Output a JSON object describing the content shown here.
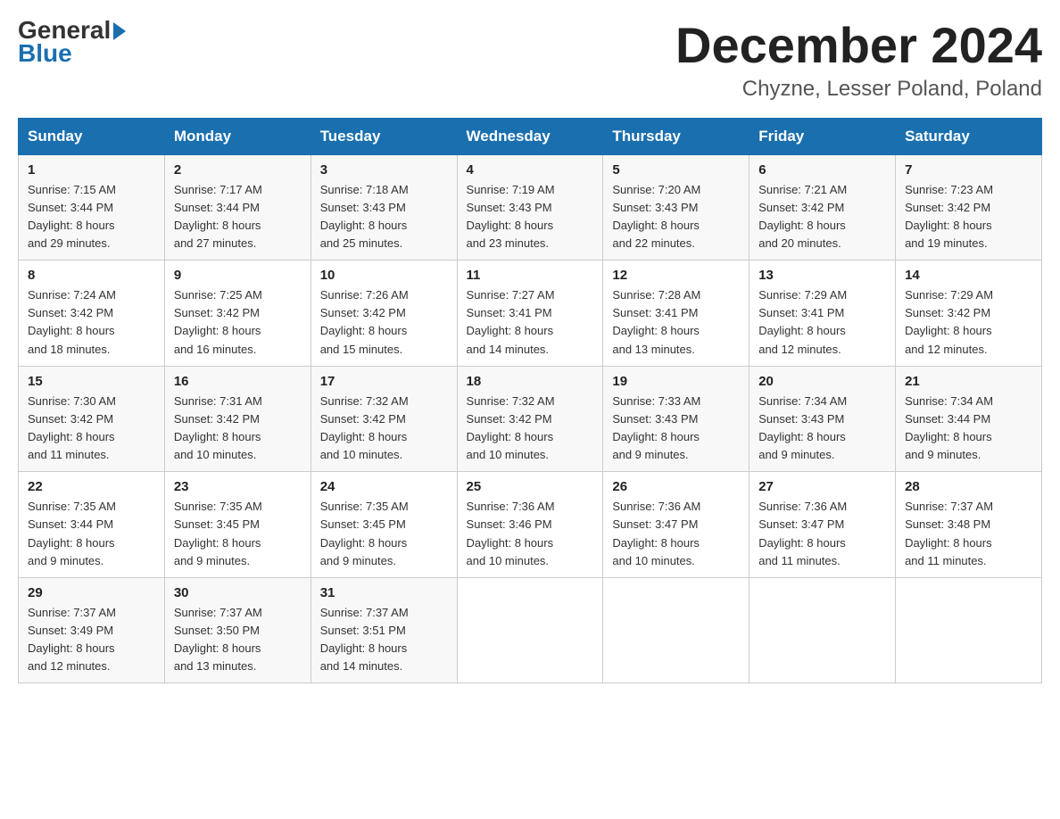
{
  "logo": {
    "general": "General",
    "blue": "Blue"
  },
  "title": "December 2024",
  "location": "Chyzne, Lesser Poland, Poland",
  "days_of_week": [
    "Sunday",
    "Monday",
    "Tuesday",
    "Wednesday",
    "Thursday",
    "Friday",
    "Saturday"
  ],
  "weeks": [
    [
      {
        "day": "1",
        "sunrise": "7:15 AM",
        "sunset": "3:44 PM",
        "daylight": "8 hours and 29 minutes."
      },
      {
        "day": "2",
        "sunrise": "7:17 AM",
        "sunset": "3:44 PM",
        "daylight": "8 hours and 27 minutes."
      },
      {
        "day": "3",
        "sunrise": "7:18 AM",
        "sunset": "3:43 PM",
        "daylight": "8 hours and 25 minutes."
      },
      {
        "day": "4",
        "sunrise": "7:19 AM",
        "sunset": "3:43 PM",
        "daylight": "8 hours and 23 minutes."
      },
      {
        "day": "5",
        "sunrise": "7:20 AM",
        "sunset": "3:43 PM",
        "daylight": "8 hours and 22 minutes."
      },
      {
        "day": "6",
        "sunrise": "7:21 AM",
        "sunset": "3:42 PM",
        "daylight": "8 hours and 20 minutes."
      },
      {
        "day": "7",
        "sunrise": "7:23 AM",
        "sunset": "3:42 PM",
        "daylight": "8 hours and 19 minutes."
      }
    ],
    [
      {
        "day": "8",
        "sunrise": "7:24 AM",
        "sunset": "3:42 PM",
        "daylight": "8 hours and 18 minutes."
      },
      {
        "day": "9",
        "sunrise": "7:25 AM",
        "sunset": "3:42 PM",
        "daylight": "8 hours and 16 minutes."
      },
      {
        "day": "10",
        "sunrise": "7:26 AM",
        "sunset": "3:42 PM",
        "daylight": "8 hours and 15 minutes."
      },
      {
        "day": "11",
        "sunrise": "7:27 AM",
        "sunset": "3:41 PM",
        "daylight": "8 hours and 14 minutes."
      },
      {
        "day": "12",
        "sunrise": "7:28 AM",
        "sunset": "3:41 PM",
        "daylight": "8 hours and 13 minutes."
      },
      {
        "day": "13",
        "sunrise": "7:29 AM",
        "sunset": "3:41 PM",
        "daylight": "8 hours and 12 minutes."
      },
      {
        "day": "14",
        "sunrise": "7:29 AM",
        "sunset": "3:42 PM",
        "daylight": "8 hours and 12 minutes."
      }
    ],
    [
      {
        "day": "15",
        "sunrise": "7:30 AM",
        "sunset": "3:42 PM",
        "daylight": "8 hours and 11 minutes."
      },
      {
        "day": "16",
        "sunrise": "7:31 AM",
        "sunset": "3:42 PM",
        "daylight": "8 hours and 10 minutes."
      },
      {
        "day": "17",
        "sunrise": "7:32 AM",
        "sunset": "3:42 PM",
        "daylight": "8 hours and 10 minutes."
      },
      {
        "day": "18",
        "sunrise": "7:32 AM",
        "sunset": "3:42 PM",
        "daylight": "8 hours and 10 minutes."
      },
      {
        "day": "19",
        "sunrise": "7:33 AM",
        "sunset": "3:43 PM",
        "daylight": "8 hours and 9 minutes."
      },
      {
        "day": "20",
        "sunrise": "7:34 AM",
        "sunset": "3:43 PM",
        "daylight": "8 hours and 9 minutes."
      },
      {
        "day": "21",
        "sunrise": "7:34 AM",
        "sunset": "3:44 PM",
        "daylight": "8 hours and 9 minutes."
      }
    ],
    [
      {
        "day": "22",
        "sunrise": "7:35 AM",
        "sunset": "3:44 PM",
        "daylight": "8 hours and 9 minutes."
      },
      {
        "day": "23",
        "sunrise": "7:35 AM",
        "sunset": "3:45 PM",
        "daylight": "8 hours and 9 minutes."
      },
      {
        "day": "24",
        "sunrise": "7:35 AM",
        "sunset": "3:45 PM",
        "daylight": "8 hours and 9 minutes."
      },
      {
        "day": "25",
        "sunrise": "7:36 AM",
        "sunset": "3:46 PM",
        "daylight": "8 hours and 10 minutes."
      },
      {
        "day": "26",
        "sunrise": "7:36 AM",
        "sunset": "3:47 PM",
        "daylight": "8 hours and 10 minutes."
      },
      {
        "day": "27",
        "sunrise": "7:36 AM",
        "sunset": "3:47 PM",
        "daylight": "8 hours and 11 minutes."
      },
      {
        "day": "28",
        "sunrise": "7:37 AM",
        "sunset": "3:48 PM",
        "daylight": "8 hours and 11 minutes."
      }
    ],
    [
      {
        "day": "29",
        "sunrise": "7:37 AM",
        "sunset": "3:49 PM",
        "daylight": "8 hours and 12 minutes."
      },
      {
        "day": "30",
        "sunrise": "7:37 AM",
        "sunset": "3:50 PM",
        "daylight": "8 hours and 13 minutes."
      },
      {
        "day": "31",
        "sunrise": "7:37 AM",
        "sunset": "3:51 PM",
        "daylight": "8 hours and 14 minutes."
      },
      null,
      null,
      null,
      null
    ]
  ],
  "labels": {
    "sunrise": "Sunrise:",
    "sunset": "Sunset:",
    "daylight": "Daylight:"
  }
}
